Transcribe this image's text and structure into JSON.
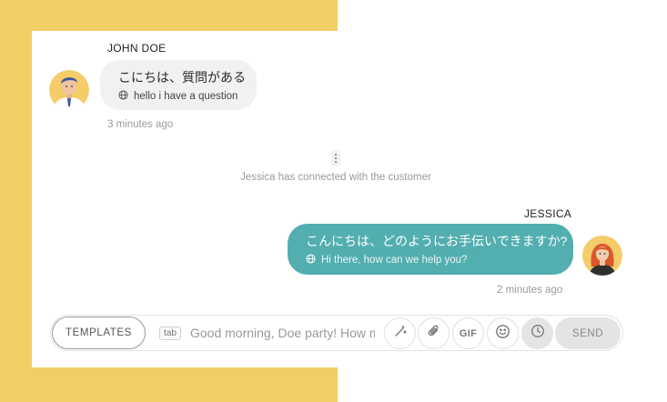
{
  "colors": {
    "accent_yellow": "#f2cf63",
    "outgoing_bubble": "#52aeaf",
    "incoming_bubble": "#f1f1f1"
  },
  "conversation": {
    "incoming": {
      "sender": "JOHN DOE",
      "text": "こにちは、質問がある",
      "translation": "hello i have a question",
      "time": "3 minutes ago",
      "translation_icon": "globe-icon"
    },
    "system_message": "Jessica has connected with the customer",
    "outgoing": {
      "sender": "JESSICA",
      "text": "こんにちは、どのようにお手伝いできますか?",
      "translation": "Hi there, how can we help you?",
      "time": "2 minutes ago",
      "translation_icon": "globe-icon"
    }
  },
  "composer": {
    "templates_label": "TEMPLATES",
    "tab_hint": "tab",
    "input_value": "Good morning, Doe party! How may I help?",
    "gif_label": "GIF",
    "send_label": "SEND",
    "tools": [
      "magic-wand-icon",
      "paperclip-icon",
      "gif",
      "smiley-icon",
      "clock-icon"
    ]
  }
}
